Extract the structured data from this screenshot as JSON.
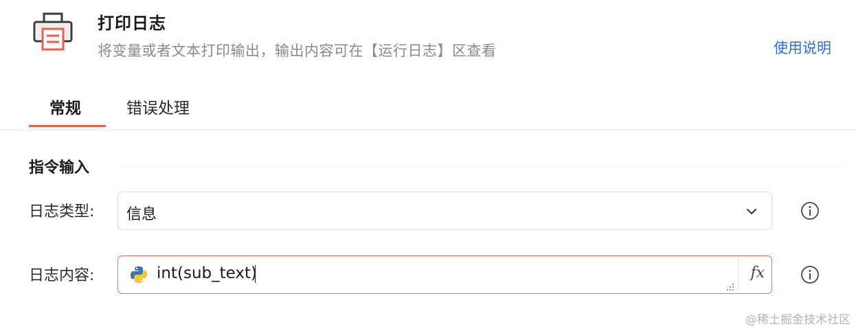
{
  "header": {
    "icon": "printer-icon",
    "title": "打印日志",
    "subtitle": "将变量或者文本打印输出，输出内容可在【运行日志】区查看",
    "help_link": "使用说明"
  },
  "tabs": [
    {
      "label": "常规",
      "active": true
    },
    {
      "label": "错误处理",
      "active": false
    }
  ],
  "section": {
    "title": "指令输入"
  },
  "fields": {
    "log_type": {
      "label": "日志类型:",
      "value": "信息",
      "icon": "chevron-down-icon",
      "info_icon": "info-icon"
    },
    "log_content": {
      "label": "日志内容:",
      "value": "int(sub_text)",
      "prefix_icon": "python-icon",
      "fx_label": "fx",
      "info_icon": "info-icon"
    }
  },
  "colors": {
    "accent": "#ec5f4c",
    "link": "#2f6fd6",
    "error_border": "#e86a5c"
  },
  "watermark": "@稀土掘金技术社区"
}
